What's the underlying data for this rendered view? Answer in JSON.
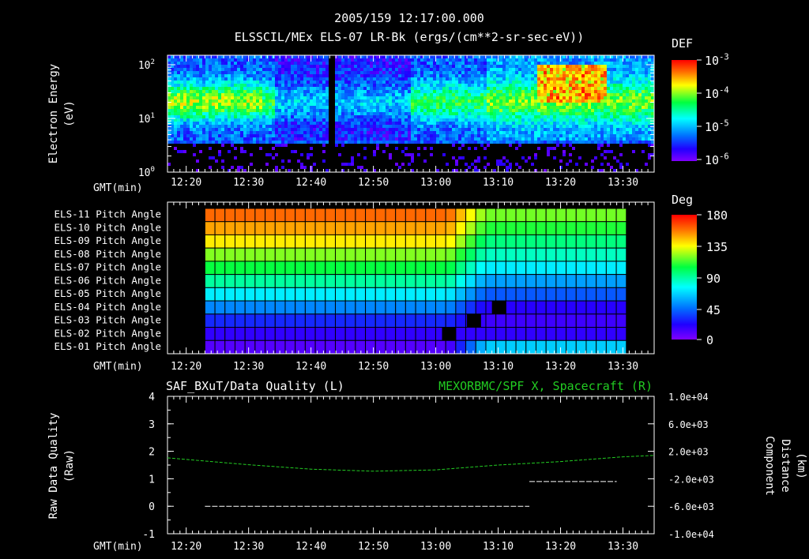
{
  "header": {
    "title_line1": "2005/159 12:17:00.000",
    "title_line2": "ELSSCIL/MEx ELS-07 LR-Bk  (ergs/(cm**2-sr-sec-eV))"
  },
  "time_axis": {
    "label": "GMT(min)",
    "ticks": [
      "12:20",
      "12:30",
      "12:40",
      "12:50",
      "13:00",
      "13:10",
      "13:20",
      "13:30"
    ]
  },
  "chart_data": [
    {
      "type": "heatmap",
      "name": "spectrogram",
      "ylabel": [
        "Electron Energy",
        "(eV)"
      ],
      "yscale": "log",
      "ylim": [
        1,
        150
      ],
      "y_ticks": [
        "10^0",
        "10^1",
        "10^2"
      ],
      "colorbar": {
        "title": "DEF",
        "ticks": [
          "10^-3",
          "10^-4",
          "10^-5",
          "10^-6"
        ],
        "scale": "log"
      },
      "features": {
        "dark_gap_time": "12:43",
        "hot_band_start": "13:16",
        "hot_band_end": "13:27",
        "cutoff_energy_ev": 4
      }
    },
    {
      "type": "heatmap",
      "name": "pitch-angle",
      "row_labels": [
        "ELS-11 Pitch Angle",
        "ELS-10 Pitch Angle",
        "ELS-09 Pitch Angle",
        "ELS-08 Pitch Angle",
        "ELS-07 Pitch Angle",
        "ELS-06 Pitch Angle",
        "ELS-05 Pitch Angle",
        "ELS-04 Pitch Angle",
        "ELS-03 Pitch Angle",
        "ELS-02 Pitch Angle",
        "ELS-01 Pitch Angle"
      ],
      "colorbar": {
        "title": "Deg",
        "ticks": [
          "180",
          "135",
          "90",
          "45",
          "0"
        ],
        "range": [
          0,
          180
        ]
      },
      "start_values_deg": [
        160,
        150,
        138,
        120,
        105,
        90,
        72,
        50,
        30,
        18,
        10
      ],
      "end_values_deg": [
        118,
        108,
        95,
        85,
        72,
        55,
        40,
        20,
        15,
        18,
        65
      ],
      "transition_time": "13:04",
      "data_start": "12:23",
      "data_end": "13:29"
    },
    {
      "type": "line",
      "name": "quality-and-position",
      "left_title": "SAF_BXuT/Data Quality (L)",
      "right_title": "MEXORBMC/SPF X, Spacecraft (R)",
      "ylabel_left": [
        "Raw Data Quality",
        "(Raw)"
      ],
      "ylabel_right": [
        "Component",
        "Distance",
        "(km)"
      ],
      "ylim_left": [
        -1,
        4
      ],
      "yticks_left": [
        "4",
        "3",
        "2",
        "1",
        "0",
        "-1"
      ],
      "ylim_right": [
        -10000,
        10000
      ],
      "yticks_right": [
        "1.0e+04",
        "6.0e+03",
        "2.0e+03",
        "-2.0e+03",
        "-6.0e+03",
        "-1.0e+04"
      ],
      "series": [
        {
          "name": "SAF_BXuT/Data Quality",
          "color": "#ffffff",
          "segments": [
            {
              "x": [
                "12:23",
                "13:15"
              ],
              "y": [
                0,
                0
              ]
            },
            {
              "x": [
                "13:15",
                "13:29"
              ],
              "y": [
                0.9,
                0.9
              ]
            }
          ]
        },
        {
          "name": "MEXORBMC/SPF X",
          "color": "#22cc22",
          "x": [
            "12:17",
            "12:30",
            "12:40",
            "12:50",
            "13:00",
            "13:10",
            "13:20",
            "13:30",
            "13:35"
          ],
          "y": [
            1050,
            50,
            -600,
            -900,
            -700,
            0,
            500,
            1200,
            1400
          ]
        }
      ]
    }
  ],
  "colors": {
    "background": "#000000",
    "text": "#ffffff",
    "right_title": "#22cc22"
  }
}
